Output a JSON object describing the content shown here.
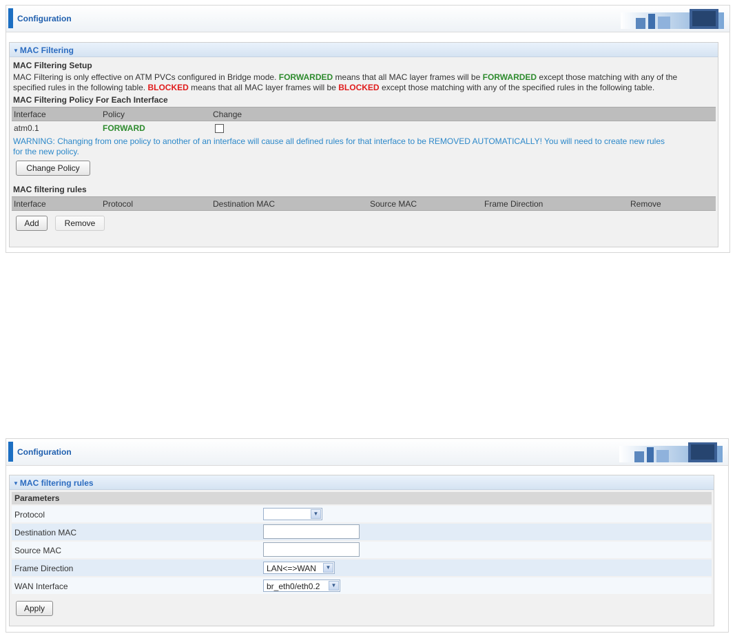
{
  "config_title": "Configuration",
  "top": {
    "section_title": "MAC Filtering",
    "setup_heading": "MAC Filtering Setup",
    "desc": {
      "p1": "MAC Filtering is only effective on ATM PVCs configured in Bridge mode.",
      "forwarded1": "FORWARDED",
      "p2": "means that all MAC layer frames will be",
      "forwarded2": "FORWARDED",
      "p3": "except those matching with any of the",
      "p4": "specified rules in the following table.",
      "blocked1": "BLOCKED",
      "p5": "means that all MAC layer frames will be",
      "blocked2": "BLOCKED",
      "p6": "except those matching with any of the specified rules in the following table."
    },
    "policy_heading": "MAC Filtering Policy For Each Interface",
    "policy_headers": [
      "Interface",
      "Policy",
      "Change"
    ],
    "policy_row": {
      "interface": "atm0.1",
      "policy": "FORWARD"
    },
    "warning_line1": "WARNING: Changing from one policy to another of an interface will cause all defined rules for that interface to be REMOVED AUTOMATICALLY! You will need to create new rules",
    "warning_line2": "for the new policy.",
    "change_policy_label": "Change Policy",
    "rules_heading": "MAC filtering rules",
    "rules_headers": [
      "Interface",
      "Protocol",
      "Destination MAC",
      "Source MAC",
      "Frame Direction",
      "Remove"
    ],
    "add_label": "Add",
    "remove_label": "Remove"
  },
  "bottom": {
    "section_title": "MAC filtering rules",
    "params_heading": "Parameters",
    "fields": {
      "protocol": {
        "label": "Protocol",
        "value": ""
      },
      "dest_mac": {
        "label": "Destination MAC",
        "value": ""
      },
      "src_mac": {
        "label": "Source MAC",
        "value": ""
      },
      "frame_direction": {
        "label": "Frame Direction",
        "value": "LAN<=>WAN"
      },
      "wan_interface": {
        "label": "WAN Interface",
        "value": "br_eth0/eth0.2"
      }
    },
    "apply_label": "Apply"
  },
  "colors": {
    "accent": "#1d6fc2",
    "forward": "#2e8b2e",
    "blocked": "#e01c1c",
    "warning": "#2c88c9"
  }
}
